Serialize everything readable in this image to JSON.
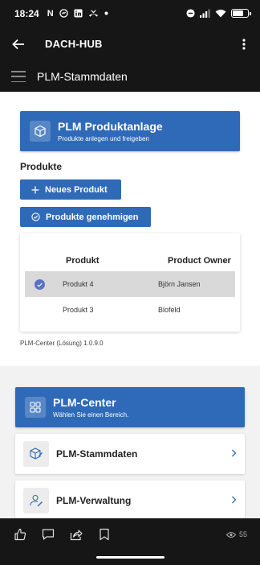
{
  "status_bar": {
    "time": "18:24",
    "notification_icons": [
      "netflix-n-icon",
      "messenger-icon",
      "linkedin-icon",
      "missed-call-icon",
      "dot-icon"
    ],
    "n_label": "N",
    "battery_level": 0.75
  },
  "app_bar": {
    "title": "DACH-HUB"
  },
  "site_header": {
    "title": "PLM-Stammdaten"
  },
  "product_banner": {
    "title": "PLM Produktanlage",
    "subtitle": "Produkte anlegen und freigeben"
  },
  "products": {
    "section_title": "Produkte",
    "new_button": "Neues Produkt",
    "approve_button": "Produkte genehmigen",
    "table": {
      "columns": [
        "Produkt",
        "Product Owner"
      ],
      "rows": [
        {
          "product": "Produkt 4",
          "owner": "Björn Jansen",
          "selected": true
        },
        {
          "product": "Produkt 3",
          "owner": "Blofeld",
          "selected": false
        }
      ]
    },
    "version": "PLM-Center (Lösung) 1.0.9.0"
  },
  "plm_center": {
    "title": "PLM-Center",
    "subtitle": "Wählen Sie einen Bereich.",
    "items": [
      {
        "label": "PLM-Stammdaten",
        "icon": "box-pencil-icon"
      },
      {
        "label": "PLM-Verwaltung",
        "icon": "user-edit-icon"
      }
    ]
  },
  "bottom_bar": {
    "views_count": "55"
  },
  "colors": {
    "accent": "#2f6ab8",
    "dark_bar": "#161616",
    "selected_row": "#d9d9d9",
    "check": "#5a73c4"
  }
}
